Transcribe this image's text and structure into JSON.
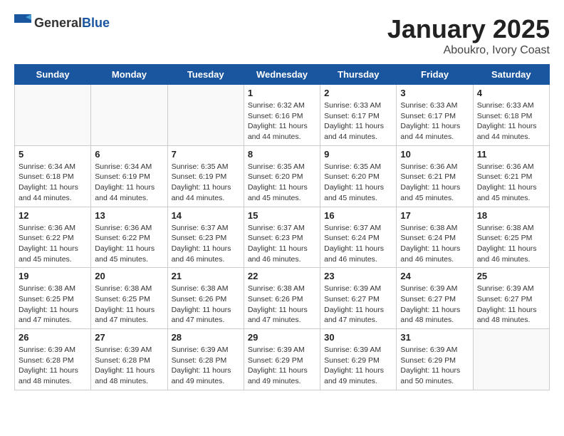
{
  "header": {
    "logo_general": "General",
    "logo_blue": "Blue",
    "month": "January 2025",
    "location": "Aboukro, Ivory Coast"
  },
  "weekdays": [
    "Sunday",
    "Monday",
    "Tuesday",
    "Wednesday",
    "Thursday",
    "Friday",
    "Saturday"
  ],
  "weeks": [
    [
      {
        "day": "",
        "info": ""
      },
      {
        "day": "",
        "info": ""
      },
      {
        "day": "",
        "info": ""
      },
      {
        "day": "1",
        "info": "Sunrise: 6:32 AM\nSunset: 6:16 PM\nDaylight: 11 hours and 44 minutes."
      },
      {
        "day": "2",
        "info": "Sunrise: 6:33 AM\nSunset: 6:17 PM\nDaylight: 11 hours and 44 minutes."
      },
      {
        "day": "3",
        "info": "Sunrise: 6:33 AM\nSunset: 6:17 PM\nDaylight: 11 hours and 44 minutes."
      },
      {
        "day": "4",
        "info": "Sunrise: 6:33 AM\nSunset: 6:18 PM\nDaylight: 11 hours and 44 minutes."
      }
    ],
    [
      {
        "day": "5",
        "info": "Sunrise: 6:34 AM\nSunset: 6:18 PM\nDaylight: 11 hours and 44 minutes."
      },
      {
        "day": "6",
        "info": "Sunrise: 6:34 AM\nSunset: 6:19 PM\nDaylight: 11 hours and 44 minutes."
      },
      {
        "day": "7",
        "info": "Sunrise: 6:35 AM\nSunset: 6:19 PM\nDaylight: 11 hours and 44 minutes."
      },
      {
        "day": "8",
        "info": "Sunrise: 6:35 AM\nSunset: 6:20 PM\nDaylight: 11 hours and 45 minutes."
      },
      {
        "day": "9",
        "info": "Sunrise: 6:35 AM\nSunset: 6:20 PM\nDaylight: 11 hours and 45 minutes."
      },
      {
        "day": "10",
        "info": "Sunrise: 6:36 AM\nSunset: 6:21 PM\nDaylight: 11 hours and 45 minutes."
      },
      {
        "day": "11",
        "info": "Sunrise: 6:36 AM\nSunset: 6:21 PM\nDaylight: 11 hours and 45 minutes."
      }
    ],
    [
      {
        "day": "12",
        "info": "Sunrise: 6:36 AM\nSunset: 6:22 PM\nDaylight: 11 hours and 45 minutes."
      },
      {
        "day": "13",
        "info": "Sunrise: 6:36 AM\nSunset: 6:22 PM\nDaylight: 11 hours and 45 minutes."
      },
      {
        "day": "14",
        "info": "Sunrise: 6:37 AM\nSunset: 6:23 PM\nDaylight: 11 hours and 46 minutes."
      },
      {
        "day": "15",
        "info": "Sunrise: 6:37 AM\nSunset: 6:23 PM\nDaylight: 11 hours and 46 minutes."
      },
      {
        "day": "16",
        "info": "Sunrise: 6:37 AM\nSunset: 6:24 PM\nDaylight: 11 hours and 46 minutes."
      },
      {
        "day": "17",
        "info": "Sunrise: 6:38 AM\nSunset: 6:24 PM\nDaylight: 11 hours and 46 minutes."
      },
      {
        "day": "18",
        "info": "Sunrise: 6:38 AM\nSunset: 6:25 PM\nDaylight: 11 hours and 46 minutes."
      }
    ],
    [
      {
        "day": "19",
        "info": "Sunrise: 6:38 AM\nSunset: 6:25 PM\nDaylight: 11 hours and 47 minutes."
      },
      {
        "day": "20",
        "info": "Sunrise: 6:38 AM\nSunset: 6:25 PM\nDaylight: 11 hours and 47 minutes."
      },
      {
        "day": "21",
        "info": "Sunrise: 6:38 AM\nSunset: 6:26 PM\nDaylight: 11 hours and 47 minutes."
      },
      {
        "day": "22",
        "info": "Sunrise: 6:38 AM\nSunset: 6:26 PM\nDaylight: 11 hours and 47 minutes."
      },
      {
        "day": "23",
        "info": "Sunrise: 6:39 AM\nSunset: 6:27 PM\nDaylight: 11 hours and 47 minutes."
      },
      {
        "day": "24",
        "info": "Sunrise: 6:39 AM\nSunset: 6:27 PM\nDaylight: 11 hours and 48 minutes."
      },
      {
        "day": "25",
        "info": "Sunrise: 6:39 AM\nSunset: 6:27 PM\nDaylight: 11 hours and 48 minutes."
      }
    ],
    [
      {
        "day": "26",
        "info": "Sunrise: 6:39 AM\nSunset: 6:28 PM\nDaylight: 11 hours and 48 minutes."
      },
      {
        "day": "27",
        "info": "Sunrise: 6:39 AM\nSunset: 6:28 PM\nDaylight: 11 hours and 48 minutes."
      },
      {
        "day": "28",
        "info": "Sunrise: 6:39 AM\nSunset: 6:28 PM\nDaylight: 11 hours and 49 minutes."
      },
      {
        "day": "29",
        "info": "Sunrise: 6:39 AM\nSunset: 6:29 PM\nDaylight: 11 hours and 49 minutes."
      },
      {
        "day": "30",
        "info": "Sunrise: 6:39 AM\nSunset: 6:29 PM\nDaylight: 11 hours and 49 minutes."
      },
      {
        "day": "31",
        "info": "Sunrise: 6:39 AM\nSunset: 6:29 PM\nDaylight: 11 hours and 50 minutes."
      },
      {
        "day": "",
        "info": ""
      }
    ]
  ]
}
